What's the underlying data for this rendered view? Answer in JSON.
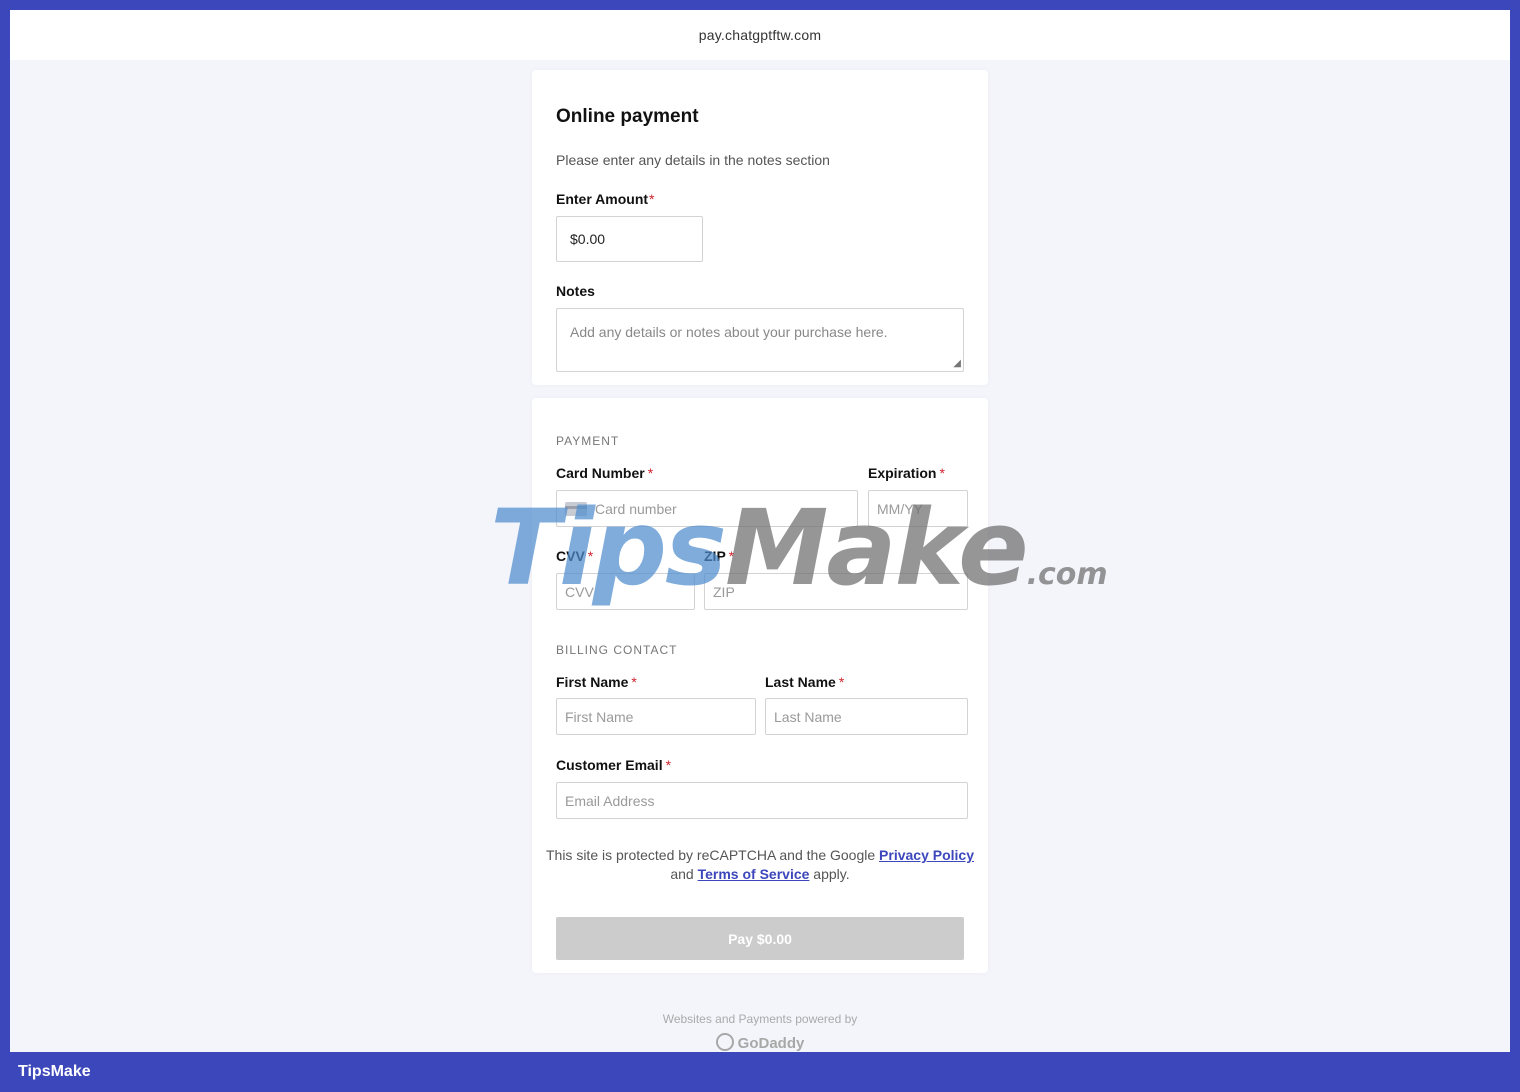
{
  "browser": {
    "url": "pay.chatgptftw.com"
  },
  "form": {
    "title": "Online payment",
    "subtitle": "Please enter any details in the notes section",
    "amount_label": "Enter Amount",
    "amount_value": "$0.00",
    "notes_label": "Notes",
    "notes_placeholder": "Add any details or notes about your purchase here."
  },
  "payment": {
    "section_title": "PAYMENT",
    "card_number_label": "Card Number",
    "card_number_placeholder": "Card number",
    "expiration_label": "Expiration",
    "expiration_placeholder": "MM/YY",
    "cvv_label": "CVV",
    "cvv_placeholder": "CVV",
    "zip_label": "ZIP",
    "zip_placeholder": "ZIP"
  },
  "billing": {
    "section_title": "BILLING CONTACT",
    "first_name_label": "First Name",
    "first_name_placeholder": "First Name",
    "last_name_label": "Last Name",
    "last_name_placeholder": "Last Name",
    "email_label": "Customer Email",
    "email_placeholder": "Email Address"
  },
  "required_marker": "*",
  "legal": {
    "text_before": "This site is protected by reCAPTCHA and the Google",
    "privacy_link": "Privacy Policy",
    "text_middle": "and",
    "terms_link": "Terms of Service",
    "text_after": "apply."
  },
  "pay_button_label": "Pay $0.00",
  "powered_by": "Websites and Payments powered by",
  "godaddy_logo_text": "GoDaddy",
  "watermark": {
    "part1": "Tips",
    "part2": "Make",
    "part3": ".com"
  },
  "footer_brand": "TipsMake",
  "colors": {
    "frame": "#3d47bc",
    "link": "#3d47bc",
    "required": "#d0232c",
    "button_disabled": "#cccccc"
  }
}
